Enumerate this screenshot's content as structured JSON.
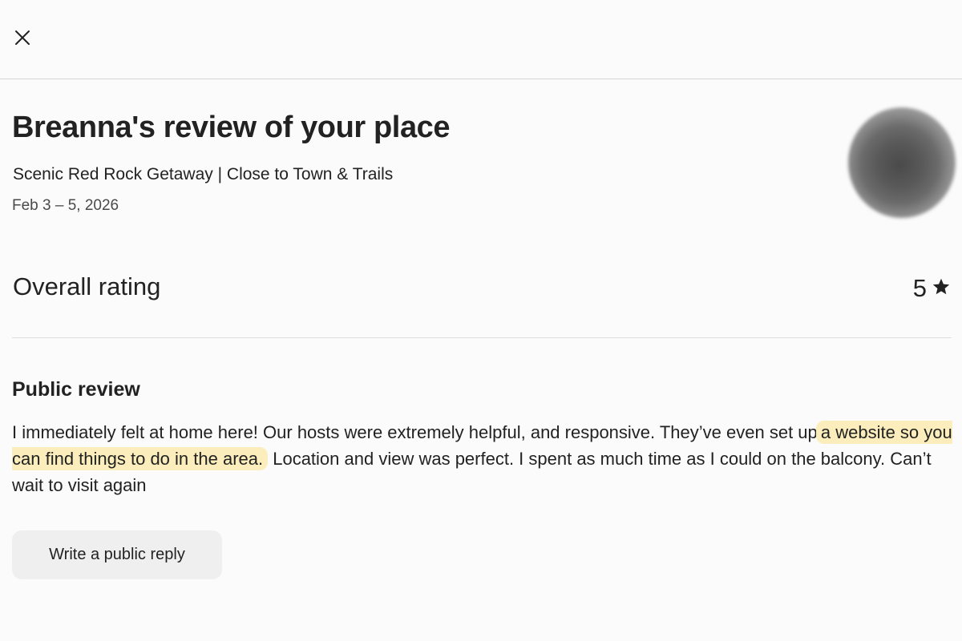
{
  "modal": {
    "close_icon": "close-icon",
    "title": "Breanna's review of your place",
    "listing_name": "Scenic Red Rock Getaway | Close to Town & Trails",
    "dates": "Feb 3 – 5, 2026"
  },
  "rating": {
    "label": "Overall rating",
    "value": "5",
    "icon": "star-icon"
  },
  "review": {
    "section_title": "Public review",
    "text_before": "I immediately felt at home here! Our hosts were extremely helpful, and responsive. They’ve even set up ",
    "text_highlighted": "a website so you can find things to do in the area.",
    "text_after": " Location and view was perfect. I spent as much time as I could on the balcony. Can’t wait to visit again",
    "highlight_color": "#fbeebc"
  },
  "actions": {
    "reply_label": "Write a public reply"
  }
}
